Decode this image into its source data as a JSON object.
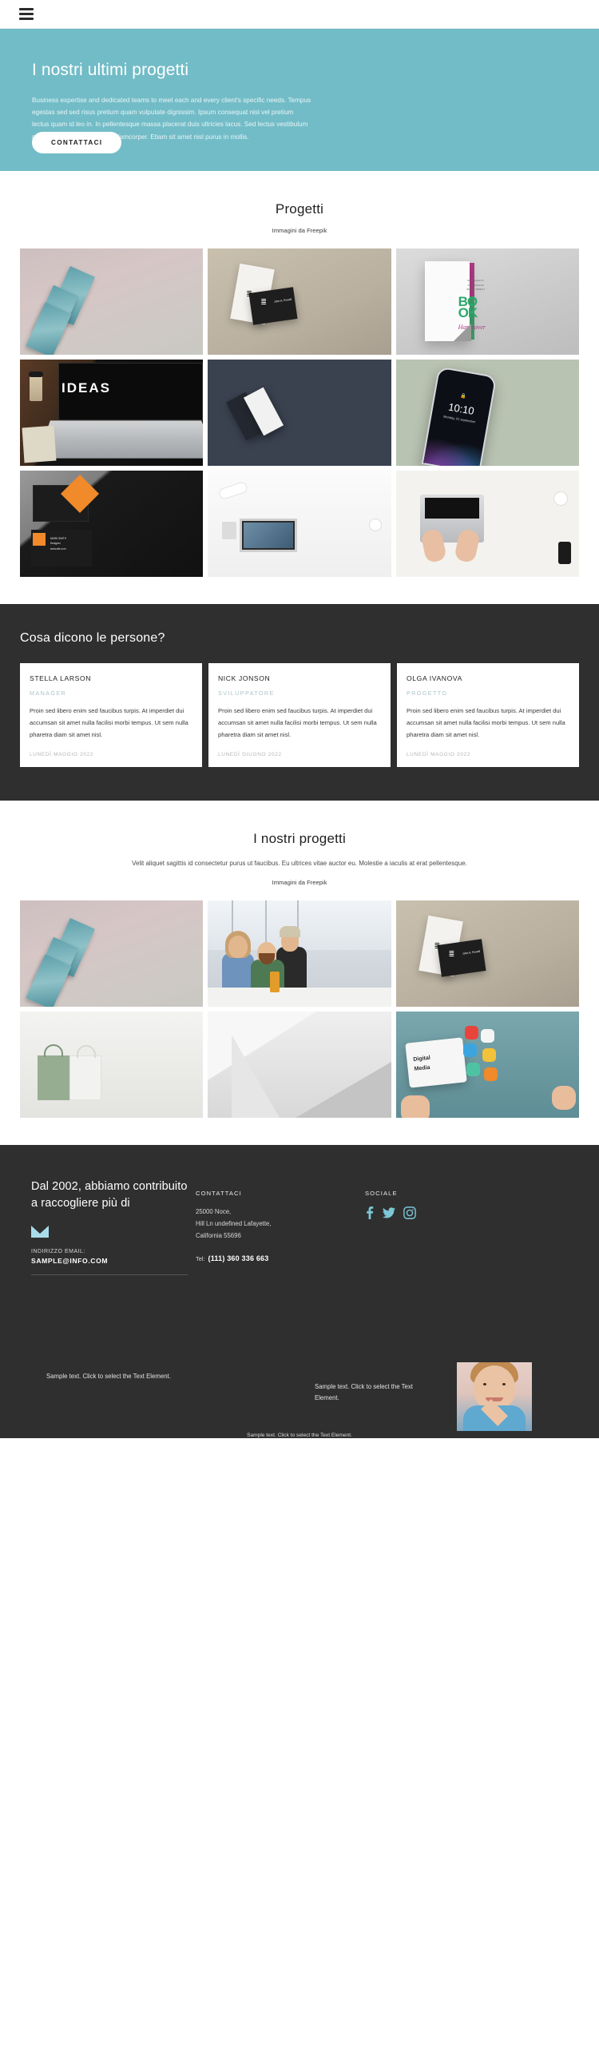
{
  "topbar": {
    "menu_icon": "hamburger-icon"
  },
  "hero": {
    "title": "I nostri ultimi progetti",
    "text": "Business expertise and dedicated teams to meet each and every client's specific needs. Tempus egestas sed sed risus pretium quam vulputate dignissim. Ipsum consequat nisl vel pretium lectus quam id leo in. In pellentesque massa placerat duis ultricies lacus. Sed lectus vestibulum mattis ullamcorper velit sed ullamcorper. Etiam sit amet nisl purus in mollis.",
    "cta_label": "CONTATTACI",
    "bg_color": "#72bcc7"
  },
  "projects_section": {
    "title": "Progetti",
    "credit": "Immagini da Freepik"
  },
  "testimonials": {
    "title": "Cosa dicono le persone?",
    "bg_color": "#2f2f2f",
    "cards": [
      {
        "name": "STELLA LARSON",
        "role": "MANAGER",
        "text": "Proin sed libero enim sed faucibus turpis. At imperdiet dui accumsan sit amet nulla facilisi morbi tempus. Ut sem nulla pharetra diam sit amet nisl.",
        "date": "LUNEDÌ MAGGIO 2022"
      },
      {
        "name": "NICK JONSON",
        "role": "SVILUPPATORE",
        "text": "Proin sed libero enim sed faucibus turpis. At imperdiet dui accumsan sit amet nulla facilisi morbi tempus. Ut sem nulla pharetra diam sit amet nisl.",
        "date": "LUNEDÌ GIUGNO 2022"
      },
      {
        "name": "OLGA IVANOVA",
        "role": "PROGETTO",
        "text": "Proin sed libero enim sed faucibus turpis. At imperdiet dui accumsan sit amet nulla facilisi morbi tempus. Ut sem nulla pharetra diam sit amet nisl.",
        "date": "LUNEDÌ MAGGIO 2022"
      }
    ]
  },
  "our_projects_section": {
    "title": "I nostri progetti",
    "subtitle": "Velit aliquet sagittis id consectetur purus ut faucibus. Eu ultrices vitae auctor eu. Molestie a iaculis at erat pellentesque.",
    "credit": "Immagini da Freepik"
  },
  "footer": {
    "heading": "Dal 2002, abbiamo contribuito a raccogliere più di",
    "mail_icon": "envelope-icon",
    "email_label": "INDIRIZZO EMAIL:",
    "email": "SAMPLE@INFO.COM",
    "contact": {
      "title": "CONTATTACI",
      "address_line1": "25000 Noce,",
      "address_line2": "Hill Ln undefined Lafayette,",
      "address_line3": "California 55696",
      "tel_label": "Tel:",
      "tel_value": "(111) 360 336 663"
    },
    "social": {
      "title": "SOCIALE",
      "items": [
        "facebook-icon",
        "twitter-icon",
        "instagram-icon"
      ],
      "color": "#7cc6d6"
    },
    "sample_left": "Sample text. Click to select the Text Element.",
    "sample_mid": "Sample text. Click to select the Text Element.",
    "sample_bottom": "Sample text. Click to select the Text Element.",
    "avatar": "person-portrait"
  }
}
